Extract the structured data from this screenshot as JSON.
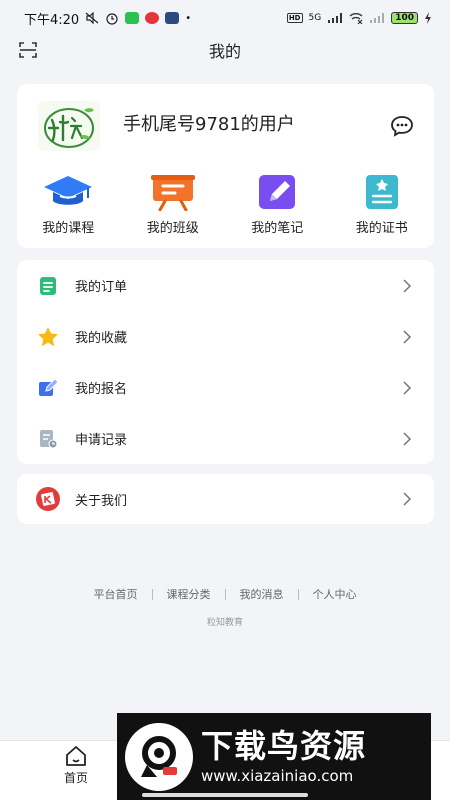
{
  "status_bar": {
    "time": "下午4:20",
    "network_label": "5G",
    "battery_level": "100"
  },
  "header": {
    "title": "我的"
  },
  "profile": {
    "username": "手机尾号9781的用户",
    "avatar_icon": "brand-logo-icon"
  },
  "quick_actions": [
    {
      "label": "我的课程",
      "icon": "graduation-cap-icon",
      "color": "#2f7cf6"
    },
    {
      "label": "我的班级",
      "icon": "presentation-board-icon",
      "color": "#f2742a"
    },
    {
      "label": "我的笔记",
      "icon": "note-pencil-icon",
      "color": "#7a4df0"
    },
    {
      "label": "我的证书",
      "icon": "certificate-icon",
      "color": "#3cb8cf"
    }
  ],
  "menu": {
    "items": [
      {
        "label": "我的订单",
        "icon": "order-list-icon",
        "color": "#2dbb7e"
      },
      {
        "label": "我的收藏",
        "icon": "star-icon",
        "color": "#f6b915"
      },
      {
        "label": "我的报名",
        "icon": "signup-edit-icon",
        "color": "#3d6ff0"
      },
      {
        "label": "申请记录",
        "icon": "application-record-icon",
        "color": "#8a99aa"
      }
    ]
  },
  "about": {
    "label": "关于我们",
    "icon": "about-logo-icon",
    "color": "#e23b3b"
  },
  "footer": {
    "links": [
      "平台首页",
      "课程分类",
      "我的消息",
      "个人中心"
    ],
    "brand": "粒知教育"
  },
  "tabbar": {
    "home_label": "首页"
  },
  "watermark": {
    "title": "下载鸟资源",
    "url": "www.xiazainiao.com"
  }
}
